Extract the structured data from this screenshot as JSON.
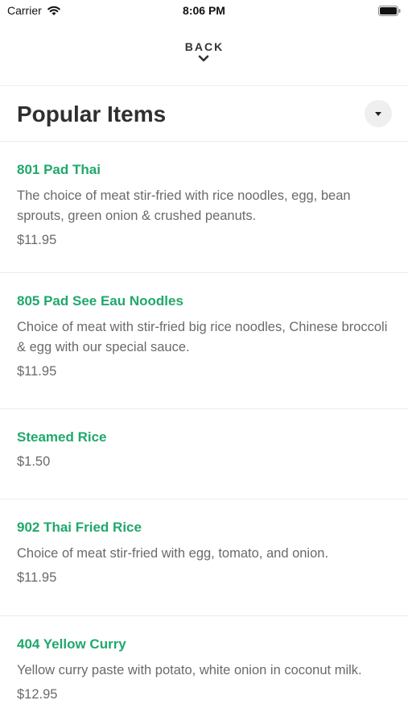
{
  "status_bar": {
    "carrier": "Carrier",
    "time": "8:06 PM"
  },
  "nav": {
    "back_label": "BACK"
  },
  "section": {
    "title": "Popular Items"
  },
  "colors": {
    "accent": "#1fa86b",
    "text_dark": "#2f2f2f",
    "text_muted": "#6a6a6a",
    "divider": "#ececec"
  },
  "items": [
    {
      "name": "801 Pad Thai",
      "description": "The choice of meat stir-fried with rice noodles, egg, bean sprouts, green onion & crushed peanuts.",
      "price": "$11.95"
    },
    {
      "name": "805 Pad See Eau Noodles",
      "description": "Choice of meat with stir-fried big rice noodles, Chinese broccoli & egg with our special sauce.",
      "price": "$11.95"
    },
    {
      "name": "Steamed Rice",
      "description": "",
      "price": "$1.50"
    },
    {
      "name": "902 Thai Fried Rice",
      "description": "Choice of meat stir-fried with egg, tomato, and onion.",
      "price": "$11.95"
    },
    {
      "name": "404 Yellow Curry",
      "description": "Yellow curry paste with potato, white onion in coconut milk.",
      "price": "$12.95"
    }
  ]
}
